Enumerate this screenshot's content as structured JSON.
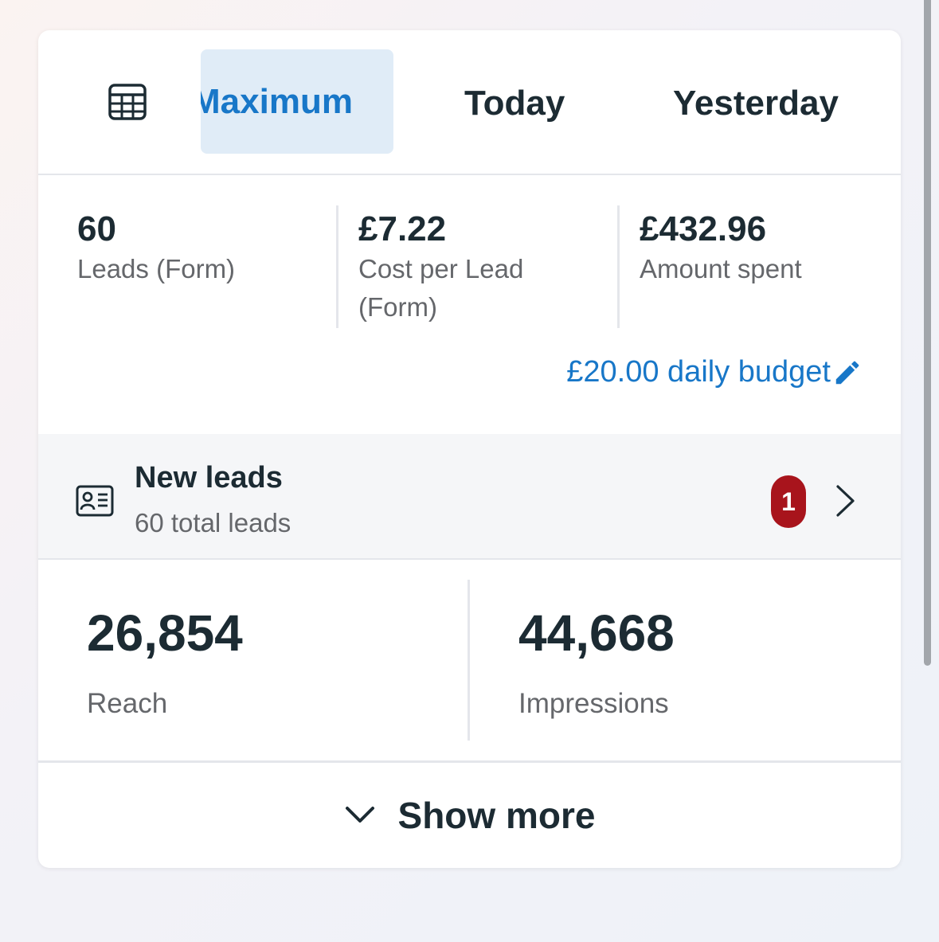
{
  "tabs": {
    "calendar_icon": "calendar-icon",
    "items": [
      {
        "label": "Maximum",
        "selected": true
      },
      {
        "label": "Today",
        "selected": false
      },
      {
        "label": "Yesterday",
        "selected": false
      }
    ]
  },
  "metrics": [
    {
      "value": "60",
      "label": "Leads (Form)"
    },
    {
      "value": "£7.22",
      "label": "Cost per Lead (Form)"
    },
    {
      "value": "£432.96",
      "label": "Amount spent"
    }
  ],
  "budget": {
    "label": "£20.00 daily budget",
    "icon": "pencil-icon"
  },
  "new_leads": {
    "title": "New leads",
    "subtitle": "60 total leads",
    "badge_count": "1",
    "icon": "contact-card-icon"
  },
  "stats": [
    {
      "value": "26,854",
      "label": "Reach"
    },
    {
      "value": "44,668",
      "label": "Impressions"
    }
  ],
  "show_more": {
    "label": "Show more",
    "icon": "chevron-down-icon"
  },
  "colors": {
    "accent": "#1877c8",
    "badge": "#a8141c",
    "text": "#1c2b33",
    "muted": "#65676b"
  }
}
